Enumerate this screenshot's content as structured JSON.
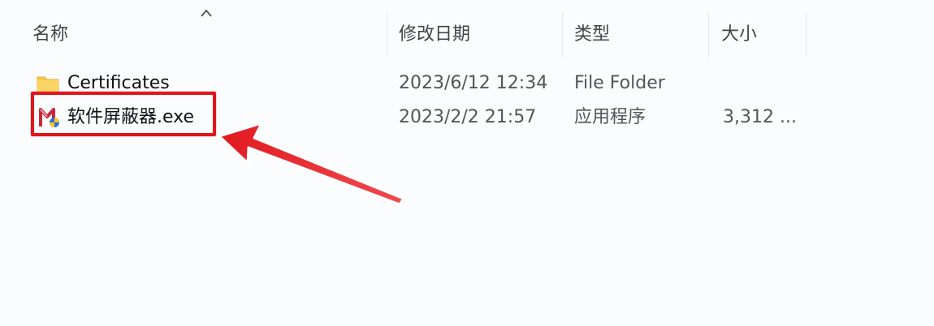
{
  "columns": {
    "name": "名称",
    "modified": "修改日期",
    "type": "类型",
    "size": "大小"
  },
  "rows": [
    {
      "name": "Certificates",
      "modified": "2023/6/12 12:34",
      "type": "File Folder",
      "size": "",
      "icon": "folder-icon"
    },
    {
      "name": "软件屏蔽器.exe",
      "modified": "2023/2/2 21:57",
      "type": "应用程序",
      "size": "3,312 ...",
      "icon": "app-icon"
    }
  ],
  "colors": {
    "highlight": "#e0161c",
    "folder": "#f6c94a"
  }
}
